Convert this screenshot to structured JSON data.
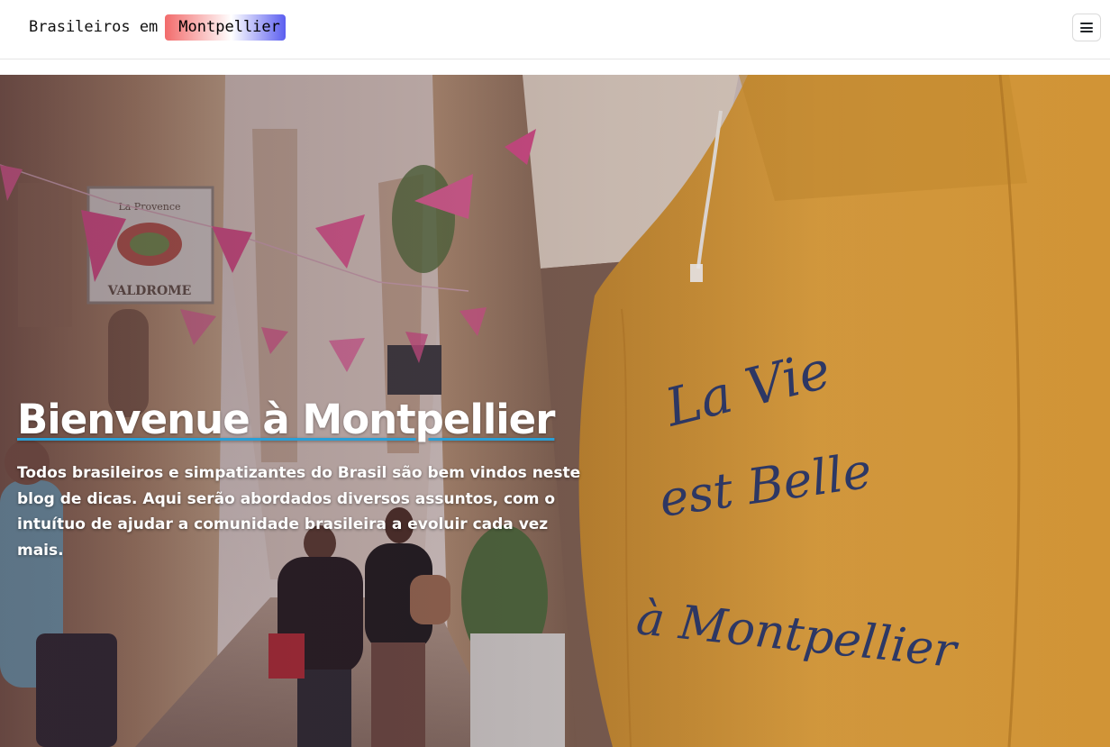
{
  "navbar": {
    "brand_prefix": "Brasileiros em",
    "brand_highlight": "Montpellier",
    "brand_gradient": [
      "#f26b6b",
      "#ffffff",
      "#5b5ef0"
    ],
    "menu_icon": "hamburger-icon"
  },
  "hero": {
    "title": "Bienvenue à Montpellier",
    "text": "Todos brasileiros e simpatizantes do Brasil são bem vindos neste blog de dicas. Aqui serão abordados diversos assuntos, com o intuítuo de ajudar a comunidade brasileira a evoluir cada vez mais.",
    "underline_color": "#2a9fd6",
    "photo": {
      "bag_text_lines": [
        "La Vie",
        "est Belle",
        "à Montpellier"
      ],
      "sign_text_lines": [
        "La Provence",
        "VALDROME"
      ]
    }
  }
}
